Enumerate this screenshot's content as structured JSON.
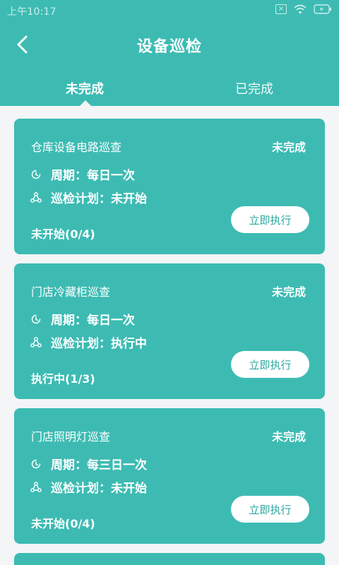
{
  "status_bar": {
    "time": "上午10:17"
  },
  "header": {
    "title": "设备巡检"
  },
  "tabs": [
    {
      "label": "未完成",
      "active": true
    },
    {
      "label": "已完成",
      "active": false
    }
  ],
  "colors": {
    "primary": "#3dbbb3",
    "background": "#f3f5f6",
    "button_text": "#2aa69f"
  },
  "cards": [
    {
      "title": "仓库设备电路巡查",
      "status": "未完成",
      "period": "周期：每日一次",
      "plan": "巡检计划：未开始",
      "progress": "未开始(0/4)",
      "button": "立即执行"
    },
    {
      "title": "门店冷藏柜巡查",
      "status": "未完成",
      "period": "周期：每日一次",
      "plan": "巡检计划：执行中",
      "progress": "执行中(1/3)",
      "button": "立即执行"
    },
    {
      "title": "门店照明灯巡查",
      "status": "未完成",
      "period": "周期：每三日一次",
      "plan": "巡检计划：未开始",
      "progress": "未开始(0/4)",
      "button": "立即执行"
    }
  ]
}
